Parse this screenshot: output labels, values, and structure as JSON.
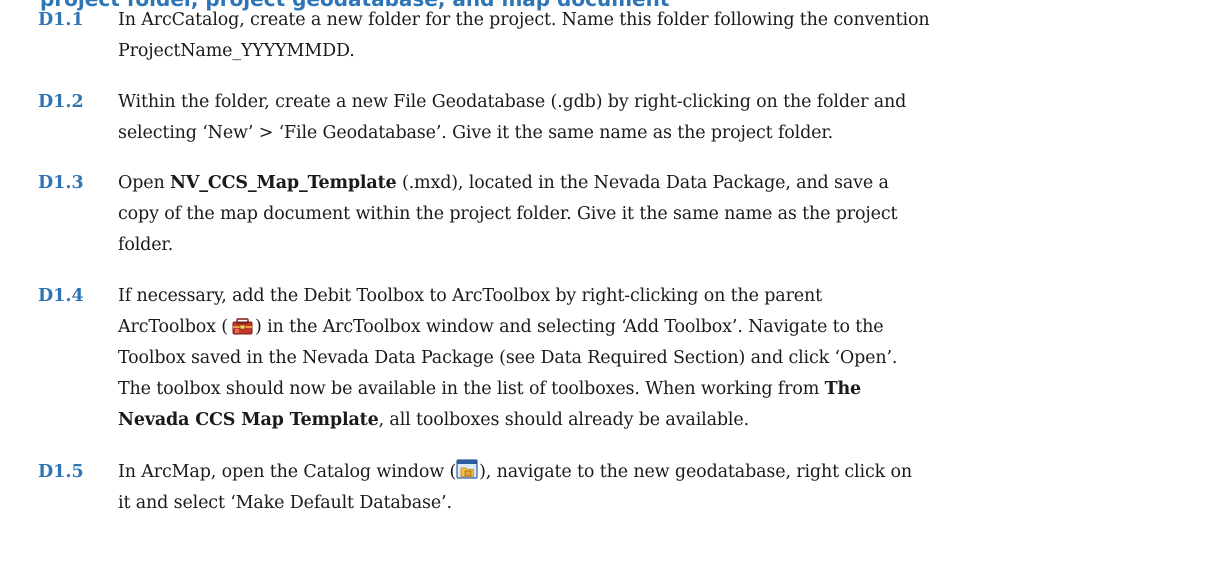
{
  "heading_fragment": "project folder, project geodatabase, and map document",
  "steps": [
    {
      "id": "D1.1",
      "lines": [
        "In ArcCatalog, create a new folder for the project. Name this folder following the convention",
        "ProjectName_YYYYMMDD."
      ]
    },
    {
      "id": "D1.2",
      "lines": [
        "Within the folder, create a new File Geodatabase (.gdb) by right-clicking on the folder and",
        "selecting ‘New’ > ‘File Geodatabase’. Give it the same name as the project folder."
      ]
    },
    {
      "id": "D1.3",
      "l1_pre": "Open ",
      "l1_bold": "NV_CCS_Map_Template",
      "l1_post": " (.mxd), located in the Nevada Data Package, and save a",
      "lines": [
        "copy of the map document within the project folder. Give it the same name as the project",
        "folder."
      ]
    },
    {
      "id": "D1.4",
      "line1": "If necessary, add the Debit Toolbox to ArcToolbox by right-clicking on the parent",
      "l2_pre": "ArcToolbox (",
      "l2_post": ") in the ArcToolbox window and selecting ‘Add Toolbox’. Navigate to the",
      "line3": "Toolbox saved in the Nevada Data Package (see Data Required Section) and click ‘Open’.",
      "line4": "The toolbox should now be available in the list of toolboxes. When working from The",
      "l4_pre": "The toolbox should now be available in the list of toolboxes. When working from ",
      "l4_bold": "The",
      "l5_bold": "Nevada CCS Map Template",
      "l5_post": ", all toolboxes should already be available.",
      "icon": "arctoolbox-icon"
    },
    {
      "id": "D1.5",
      "l1_pre": "In ArcMap, open the Catalog window (",
      "l1_post": "), navigate to the new geodatabase, right click on",
      "line2": "it and select ‘Make Default Database’.",
      "icon": "catalog-window-icon"
    }
  ]
}
